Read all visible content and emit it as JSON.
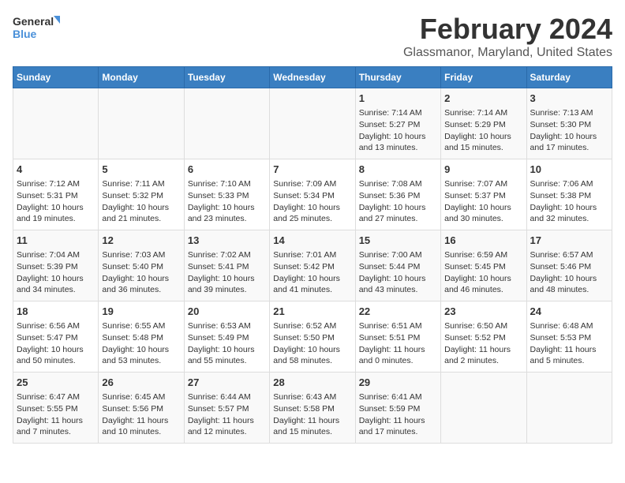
{
  "header": {
    "logo_line1": "General",
    "logo_line2": "Blue",
    "title": "February 2024",
    "subtitle": "Glassmanor, Maryland, United States"
  },
  "weekdays": [
    "Sunday",
    "Monday",
    "Tuesday",
    "Wednesday",
    "Thursday",
    "Friday",
    "Saturday"
  ],
  "weeks": [
    [
      {
        "day": "",
        "info": ""
      },
      {
        "day": "",
        "info": ""
      },
      {
        "day": "",
        "info": ""
      },
      {
        "day": "",
        "info": ""
      },
      {
        "day": "1",
        "info": "Sunrise: 7:14 AM\nSunset: 5:27 PM\nDaylight: 10 hours\nand 13 minutes."
      },
      {
        "day": "2",
        "info": "Sunrise: 7:14 AM\nSunset: 5:29 PM\nDaylight: 10 hours\nand 15 minutes."
      },
      {
        "day": "3",
        "info": "Sunrise: 7:13 AM\nSunset: 5:30 PM\nDaylight: 10 hours\nand 17 minutes."
      }
    ],
    [
      {
        "day": "4",
        "info": "Sunrise: 7:12 AM\nSunset: 5:31 PM\nDaylight: 10 hours\nand 19 minutes."
      },
      {
        "day": "5",
        "info": "Sunrise: 7:11 AM\nSunset: 5:32 PM\nDaylight: 10 hours\nand 21 minutes."
      },
      {
        "day": "6",
        "info": "Sunrise: 7:10 AM\nSunset: 5:33 PM\nDaylight: 10 hours\nand 23 minutes."
      },
      {
        "day": "7",
        "info": "Sunrise: 7:09 AM\nSunset: 5:34 PM\nDaylight: 10 hours\nand 25 minutes."
      },
      {
        "day": "8",
        "info": "Sunrise: 7:08 AM\nSunset: 5:36 PM\nDaylight: 10 hours\nand 27 minutes."
      },
      {
        "day": "9",
        "info": "Sunrise: 7:07 AM\nSunset: 5:37 PM\nDaylight: 10 hours\nand 30 minutes."
      },
      {
        "day": "10",
        "info": "Sunrise: 7:06 AM\nSunset: 5:38 PM\nDaylight: 10 hours\nand 32 minutes."
      }
    ],
    [
      {
        "day": "11",
        "info": "Sunrise: 7:04 AM\nSunset: 5:39 PM\nDaylight: 10 hours\nand 34 minutes."
      },
      {
        "day": "12",
        "info": "Sunrise: 7:03 AM\nSunset: 5:40 PM\nDaylight: 10 hours\nand 36 minutes."
      },
      {
        "day": "13",
        "info": "Sunrise: 7:02 AM\nSunset: 5:41 PM\nDaylight: 10 hours\nand 39 minutes."
      },
      {
        "day": "14",
        "info": "Sunrise: 7:01 AM\nSunset: 5:42 PM\nDaylight: 10 hours\nand 41 minutes."
      },
      {
        "day": "15",
        "info": "Sunrise: 7:00 AM\nSunset: 5:44 PM\nDaylight: 10 hours\nand 43 minutes."
      },
      {
        "day": "16",
        "info": "Sunrise: 6:59 AM\nSunset: 5:45 PM\nDaylight: 10 hours\nand 46 minutes."
      },
      {
        "day": "17",
        "info": "Sunrise: 6:57 AM\nSunset: 5:46 PM\nDaylight: 10 hours\nand 48 minutes."
      }
    ],
    [
      {
        "day": "18",
        "info": "Sunrise: 6:56 AM\nSunset: 5:47 PM\nDaylight: 10 hours\nand 50 minutes."
      },
      {
        "day": "19",
        "info": "Sunrise: 6:55 AM\nSunset: 5:48 PM\nDaylight: 10 hours\nand 53 minutes."
      },
      {
        "day": "20",
        "info": "Sunrise: 6:53 AM\nSunset: 5:49 PM\nDaylight: 10 hours\nand 55 minutes."
      },
      {
        "day": "21",
        "info": "Sunrise: 6:52 AM\nSunset: 5:50 PM\nDaylight: 10 hours\nand 58 minutes."
      },
      {
        "day": "22",
        "info": "Sunrise: 6:51 AM\nSunset: 5:51 PM\nDaylight: 11 hours\nand 0 minutes."
      },
      {
        "day": "23",
        "info": "Sunrise: 6:50 AM\nSunset: 5:52 PM\nDaylight: 11 hours\nand 2 minutes."
      },
      {
        "day": "24",
        "info": "Sunrise: 6:48 AM\nSunset: 5:53 PM\nDaylight: 11 hours\nand 5 minutes."
      }
    ],
    [
      {
        "day": "25",
        "info": "Sunrise: 6:47 AM\nSunset: 5:55 PM\nDaylight: 11 hours\nand 7 minutes."
      },
      {
        "day": "26",
        "info": "Sunrise: 6:45 AM\nSunset: 5:56 PM\nDaylight: 11 hours\nand 10 minutes."
      },
      {
        "day": "27",
        "info": "Sunrise: 6:44 AM\nSunset: 5:57 PM\nDaylight: 11 hours\nand 12 minutes."
      },
      {
        "day": "28",
        "info": "Sunrise: 6:43 AM\nSunset: 5:58 PM\nDaylight: 11 hours\nand 15 minutes."
      },
      {
        "day": "29",
        "info": "Sunrise: 6:41 AM\nSunset: 5:59 PM\nDaylight: 11 hours\nand 17 minutes."
      },
      {
        "day": "",
        "info": ""
      },
      {
        "day": "",
        "info": ""
      }
    ]
  ]
}
